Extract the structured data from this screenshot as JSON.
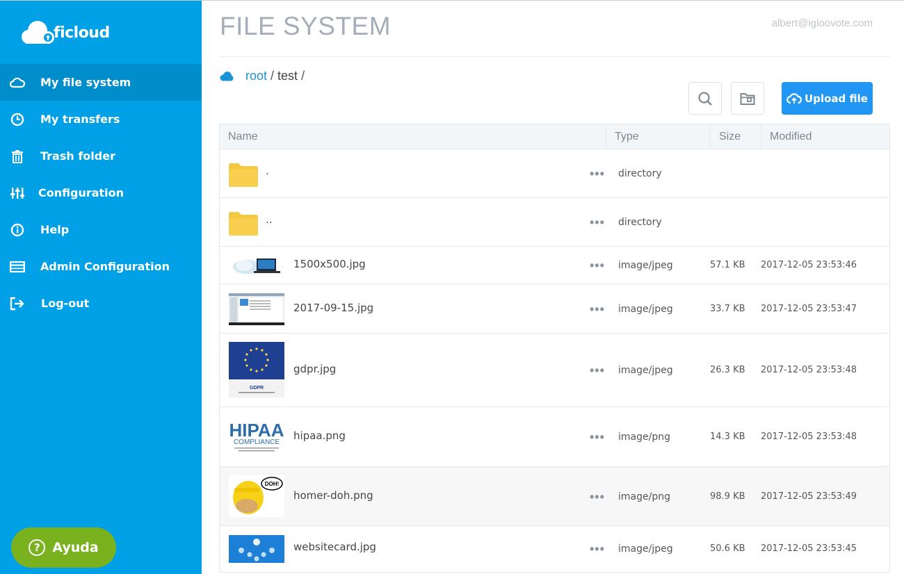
{
  "app": {
    "logo_text": "ficloud",
    "title": "FILE SYSTEM",
    "user_email": "albert@igloovote.com"
  },
  "sidebar": {
    "items": [
      {
        "label": "My file system",
        "icon": "cloud-icon",
        "active": true
      },
      {
        "label": "My transfers",
        "icon": "clock-icon"
      },
      {
        "label": "Trash folder",
        "icon": "trash-icon"
      },
      {
        "label": "Configuration",
        "icon": "sliders-icon"
      },
      {
        "label": "Help",
        "icon": "info-icon"
      },
      {
        "label": "Admin Configuration",
        "icon": "window-icon"
      },
      {
        "label": "Log-out",
        "icon": "logout-icon"
      }
    ],
    "help_button": {
      "symbol": "?",
      "label": "Ayuda"
    }
  },
  "breadcrumb": {
    "root": "root",
    "separator": "/",
    "current": "test"
  },
  "toolbar": {
    "upload_label": "Upload file"
  },
  "table": {
    "columns": [
      "Name",
      "Type",
      "Size",
      "Modified"
    ],
    "rows": [
      {
        "name": ".",
        "type": "directory",
        "size": "",
        "modified": "",
        "thumb": "folder"
      },
      {
        "name": "..",
        "type": "directory",
        "size": "",
        "modified": "",
        "thumb": "folder"
      },
      {
        "name": "1500x500.jpg",
        "type": "image/jpeg",
        "size": "57.1 KB",
        "modified": "2017-12-05 23:53:46",
        "thumb": "banner"
      },
      {
        "name": "2017-09-15.jpg",
        "type": "image/jpeg",
        "size": "33.7 KB",
        "modified": "2017-12-05 23:53:47",
        "thumb": "screenshot"
      },
      {
        "name": "gdpr.jpg",
        "type": "image/jpeg",
        "size": "26.3 KB",
        "modified": "2017-12-05 23:53:48",
        "thumb": "gdpr"
      },
      {
        "name": "hipaa.png",
        "type": "image/png",
        "size": "14.3 KB",
        "modified": "2017-12-05 23:53:48",
        "thumb": "hipaa"
      },
      {
        "name": "homer-doh.png",
        "type": "image/png",
        "size": "98.9 KB",
        "modified": "2017-12-05 23:53:49",
        "thumb": "homer"
      },
      {
        "name": "websitecard.jpg",
        "type": "image/jpeg",
        "size": "50.6 KB",
        "modified": "2017-12-05 23:53:45",
        "thumb": "websitecard"
      }
    ]
  },
  "thumb_text": {
    "gdpr": "GDPR",
    "hipaa": "HIPAA",
    "hipaa_sub": "COMPLIANCE",
    "homer": "DOH!"
  },
  "colors": {
    "sidebar": "#00a0e6",
    "sidebar_active": "#008dcb",
    "accent": "#2196f3",
    "help": "#7ab21f",
    "folder": "#f5c842"
  }
}
